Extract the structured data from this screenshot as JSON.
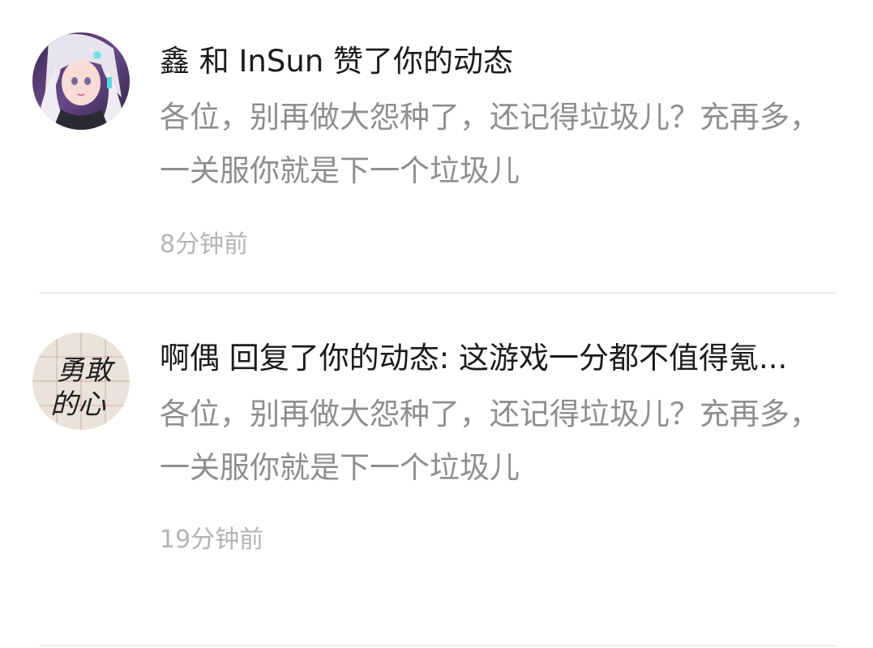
{
  "notifications": [
    {
      "title": "鑫 和 InSun 赞了你的动态",
      "body": "各位，别再做大怨种了，还记得垃圾儿？充再多，一关服你就是下一个垃圾儿",
      "time": "8分钟前",
      "avatar_icon": "anime-girl-avatar"
    },
    {
      "title": "啊偶 回复了你的动态: 这游戏一分都不值得氪...",
      "body": "各位，别再做大怨种了，还记得垃圾儿？充再多，一关服你就是下一个垃圾儿",
      "time": "19分钟前",
      "avatar_icon": "calligraphy-avatar",
      "avatar_text": "勇敢的心"
    }
  ],
  "colors": {
    "title": "#1b1b1b",
    "body": "#8e8e8e",
    "time": "#b4b4b4",
    "divider": "#ececec"
  }
}
